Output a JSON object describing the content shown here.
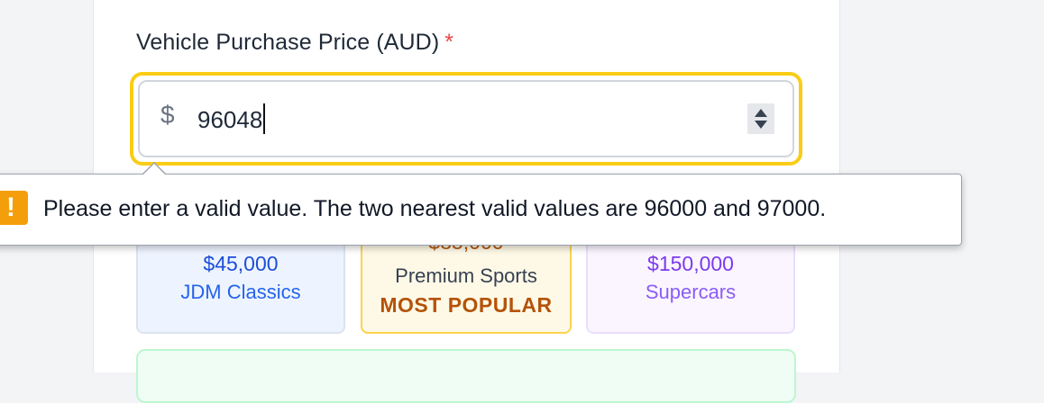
{
  "form": {
    "price_label": "Vehicle Purchase Price (AUD)",
    "required_marker": "*",
    "currency_symbol": "$",
    "price_value": "96048"
  },
  "validation": {
    "message": "Please enter a valid value. The two nearest valid values are 96000 and 97000.",
    "icon": "warning-icon"
  },
  "tiles": [
    {
      "price": "$45,000",
      "name": "JDM Classics",
      "color": "#1d4ed8"
    },
    {
      "price": "$85,000",
      "name": "Premium Sports",
      "badge": "MOST POPULAR",
      "color": "#b45309"
    },
    {
      "price": "$150,000",
      "name": "Supercars",
      "color": "#7c3aed"
    }
  ],
  "colors": {
    "focus_ring": "#facc15",
    "required": "#ef4444",
    "warning": "#f59e0b"
  }
}
